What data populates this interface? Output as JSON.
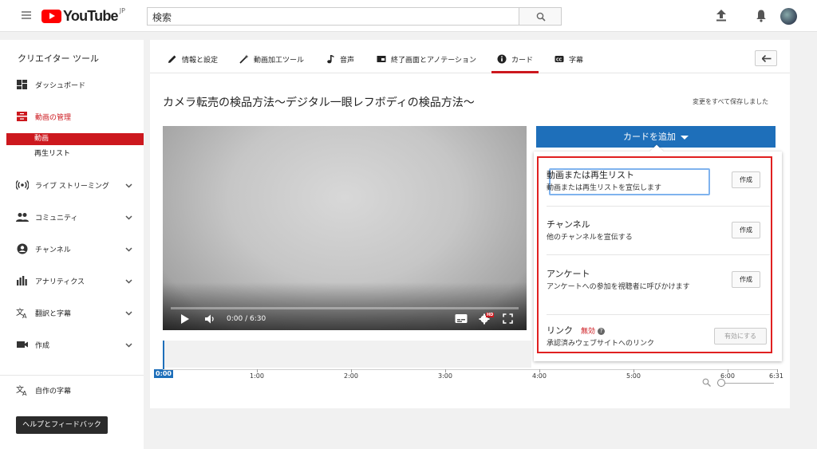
{
  "header": {
    "logo_text": "YouTube",
    "region": "JP",
    "search_placeholder": "検索"
  },
  "sidebar": {
    "title": "クリエイター ツール",
    "items": [
      {
        "label": "ダッシュボード"
      },
      {
        "label": "動画の管理"
      },
      {
        "label": "ライブ ストリーミング"
      },
      {
        "label": "コミュニティ"
      },
      {
        "label": "チャンネル"
      },
      {
        "label": "アナリティクス"
      },
      {
        "label": "翻訳と字幕"
      },
      {
        "label": "作成"
      },
      {
        "label": "自作の字幕"
      }
    ],
    "subitems": [
      {
        "label": "動画",
        "active": true
      },
      {
        "label": "再生リスト",
        "active": false
      }
    ],
    "help_button": "ヘルプとフィードバック"
  },
  "tabs": [
    {
      "label": "情報と設定"
    },
    {
      "label": "動画加工ツール"
    },
    {
      "label": "音声"
    },
    {
      "label": "終了画面とアノテーション"
    },
    {
      "label": "カード",
      "active": true
    },
    {
      "label": "字幕"
    }
  ],
  "video": {
    "title": "カメラ転売の検品方法〜デジタル一眼レフボディの検品方法〜",
    "save_status": "変更をすべて保存しました",
    "time": "0:00 / 6:30",
    "hd": "HD",
    "progress": 0
  },
  "cards": {
    "add_button": "カードを追加",
    "items": [
      {
        "title": "動画または再生リスト",
        "desc": "動画または再生リストを宣伝します",
        "button": "作成"
      },
      {
        "title": "チャンネル",
        "desc": "他のチャンネルを宣伝する",
        "button": "作成"
      },
      {
        "title": "アンケート",
        "desc": "アンケートへの参加を視聴者に呼びかけます",
        "button": "作成"
      },
      {
        "title": "リンク",
        "status": "無効",
        "help": "?",
        "desc": "承認済みウェブサイトへのリンク",
        "button": "有効にする"
      }
    ]
  },
  "timeline": {
    "playhead": "0:00",
    "ticks": [
      "1:00",
      "2:00",
      "3:00",
      "4:00",
      "5:00",
      "6:00",
      "6:31"
    ]
  },
  "colors": {
    "accent_blue": "#1e6fba",
    "brand_red": "#cc181e",
    "highlight_red": "#e02020"
  }
}
